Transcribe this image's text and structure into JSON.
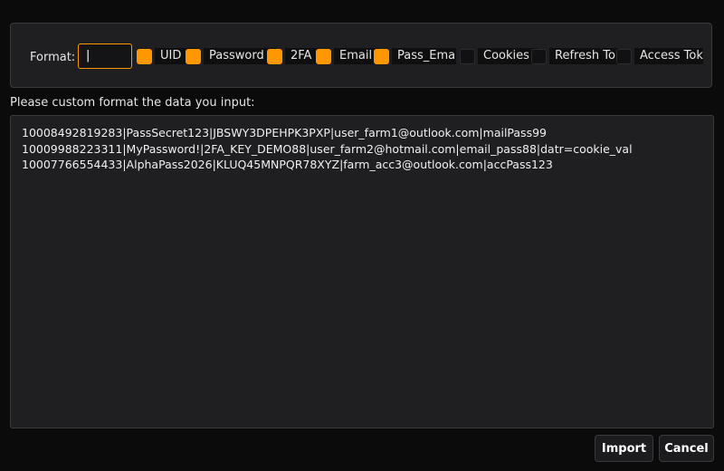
{
  "format": {
    "label": "Format:",
    "input_value": "|",
    "options": [
      {
        "label": "UID",
        "checked": true
      },
      {
        "label": "Password",
        "checked": true
      },
      {
        "label": "2FA",
        "checked": true
      },
      {
        "label": "Email",
        "checked": true
      },
      {
        "label": "Pass_Emai",
        "checked": true
      },
      {
        "label": "Cookies",
        "checked": false
      },
      {
        "label": "Refresh To",
        "checked": false
      },
      {
        "label": "Access Tok",
        "checked": false
      }
    ]
  },
  "instruction": "Please custom format the data you input:",
  "data_lines": [
    "10008492819283|PassSecret123|JBSWY3DPEHPK3PXP|user_farm1@outlook.com|mailPass99",
    "10009988223311|MyPassword!|2FA_KEY_DEMO88|user_farm2@hotmail.com|email_pass88|datr=cookie_val",
    "10007766554433|AlphaPass2026|KLUQ45MNPQR78XYZ|farm_acc3@outlook.com|accPass123"
  ],
  "buttons": {
    "import": "Import",
    "cancel": "Cancel"
  },
  "colors": {
    "accent": "#ff9800",
    "background": "#0b0b0c",
    "panel": "#1f1f22"
  }
}
